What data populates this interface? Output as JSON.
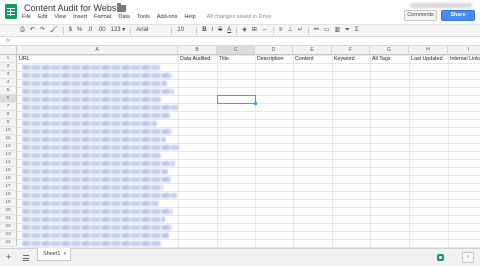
{
  "title_bar": {
    "doc_title": "Content Audit for Website",
    "star_glyph": "☆",
    "comments_label": "Comments",
    "share_label": "Share"
  },
  "menu": {
    "items": [
      "File",
      "Edit",
      "View",
      "Insert",
      "Format",
      "Data",
      "Tools",
      "Add-ons",
      "Help"
    ],
    "status": "All changes saved in Drive"
  },
  "toolbar": {
    "currency": "$",
    "percent": "%",
    "decimal_less": ".0",
    "decimal_more": ".00",
    "number_format": "123 ▾",
    "font": "Arial",
    "font_size": "10",
    "bold": "B",
    "italic": "I",
    "strike": "S",
    "text_color": "A"
  },
  "formula_bar": {
    "fx": "fx"
  },
  "grid": {
    "columns": [
      "A",
      "B",
      "C",
      "D",
      "E",
      "F",
      "G",
      "H",
      "I"
    ],
    "row_numbers": [
      "1",
      "2",
      "3",
      "4",
      "5",
      "6",
      "7",
      "8",
      "9",
      "10",
      "11",
      "12",
      "13",
      "14",
      "15",
      "16",
      "17",
      "18",
      "19",
      "20",
      "21",
      "22",
      "23",
      "24"
    ],
    "header_row": [
      "URL",
      "Data Audited",
      "Title",
      "Description",
      "Content",
      "Keyword",
      "All Tags",
      "Last Updated",
      "Internal Links"
    ],
    "selected_column": "C",
    "selected_row": "6"
  },
  "sheets": {
    "add_glyph": "+",
    "active_tab": "Sheet1",
    "caret": "▾",
    "side_glyph": "›"
  }
}
